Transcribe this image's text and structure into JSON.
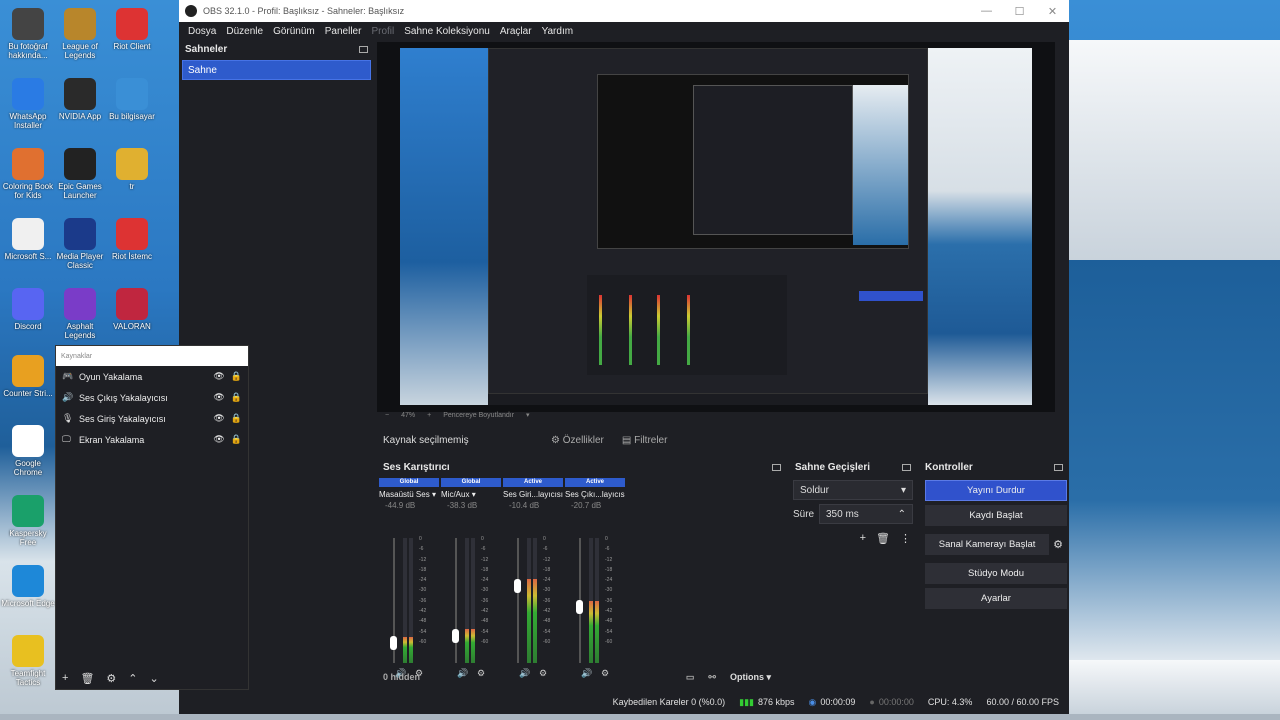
{
  "window": {
    "title": "OBS 32.1.0 - Profil: Başlıksız - Sahneler: Başlıksız"
  },
  "menu": [
    "Dosya",
    "Düzenle",
    "Görünüm",
    "Paneller",
    "Profil",
    "Sahne Koleksiyonu",
    "Araçlar",
    "Yardım"
  ],
  "scenes": {
    "title": "Sahneler",
    "items": [
      "Sahne"
    ]
  },
  "preview": {
    "zoom": "47%",
    "scale_label": "Pencereye Boyutlandır"
  },
  "source_bar": {
    "label": "Kaynak seçilmemiş",
    "properties": "Özellikler",
    "filters": "Filtreler"
  },
  "sources": {
    "title": "Kaynaklar",
    "items": [
      {
        "label": "Oyun Yakalama",
        "icon": "gamepad-icon"
      },
      {
        "label": "Ses Çıkış Yakalayıcısı",
        "icon": "speaker-icon"
      },
      {
        "label": "Ses Giriş Yakalayıcısı",
        "icon": "microphone-icon"
      },
      {
        "label": "Ekran Yakalama",
        "icon": "monitor-icon"
      }
    ]
  },
  "mixer": {
    "title": "Ses Karıştırıcı",
    "hidden": "0 hidden",
    "options": "Options",
    "channels": [
      {
        "tag": "Global",
        "name": "Masaüstü Ses",
        "db": "-44.9 dB",
        "level": 0.16
      },
      {
        "tag": "Global",
        "name": "Mic/Aux",
        "db": "-38.3 dB",
        "level": 0.22
      },
      {
        "tag": "Active",
        "name": "Ses Giri...layıcısı",
        "db": "-10.4 dB",
        "level": 0.62
      },
      {
        "tag": "Active",
        "name": "Ses Çıkı...layıcısı",
        "db": "-20.7 dB",
        "level": 0.45
      }
    ],
    "ticks": [
      "0",
      "-6",
      "-12",
      "-18",
      "-24",
      "-30",
      "-36",
      "-42",
      "-48",
      "-54",
      "-60"
    ]
  },
  "transitions": {
    "title": "Sahne Geçişleri",
    "type": "Soldur",
    "duration_label": "Süre",
    "duration": "350 ms"
  },
  "controls": {
    "title": "Kontroller",
    "buttons": [
      "Yayını Durdur",
      "Kaydı Başlat",
      "Sanal Kamerayı Başlat",
      "Stüdyo Modu",
      "Ayarlar"
    ]
  },
  "status": {
    "dropped": "Kaybedilen Kareler 0 (%0.0)",
    "kbps": "876 kbps",
    "stream_time": "00:00:09",
    "rec_time": "00:00:00",
    "cpu": "CPU: 4.3%",
    "fps": "60.00 / 60.00 FPS"
  },
  "desktop": {
    "icons": [
      "Bu fotoğraf hakkında...",
      "League of Legends",
      "Riot Client",
      "WhatsApp Installer",
      "NVIDIA App",
      "Bu bilgisayar",
      "Coloring Book for Kids",
      "Epic Games Launcher",
      "tr",
      "Microsoft S...",
      "Media Player Classic",
      "Riot İstemc",
      "Discord",
      "Asphalt Legends",
      "VALORAN",
      "Counter Stri...",
      "Google Chrome",
      "Kaspersky Free",
      "Microsoft Edge",
      "Teamfight Tactics"
    ]
  }
}
